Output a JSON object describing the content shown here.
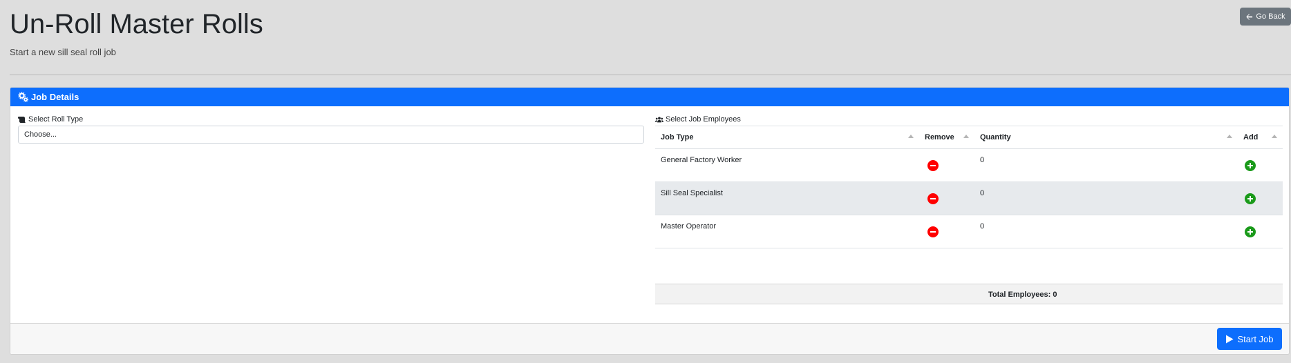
{
  "header": {
    "title": "Un-Roll Master Rolls",
    "subtitle": "Start a new sill seal roll job",
    "go_back_label": "Go Back"
  },
  "card": {
    "title": "Job Details",
    "roll_type": {
      "label": "Select Roll Type",
      "selected": "Choose..."
    },
    "employees": {
      "label": "Select Job Employees",
      "columns": {
        "job_type": "Job Type",
        "remove": "Remove",
        "quantity": "Quantity",
        "add": "Add"
      },
      "rows": [
        {
          "job_type": "General Factory Worker",
          "quantity": "0"
        },
        {
          "job_type": "Sill Seal Specialist",
          "quantity": "0"
        },
        {
          "job_type": "Master Operator",
          "quantity": "0"
        }
      ],
      "total_label": "Total Employees: 0"
    },
    "start_job_label": "Start Job"
  },
  "colors": {
    "primary": "#0d6efd",
    "secondary": "#6c757d",
    "remove": "#ff0000",
    "add": "#1a9a1a",
    "background": "#dedede"
  }
}
